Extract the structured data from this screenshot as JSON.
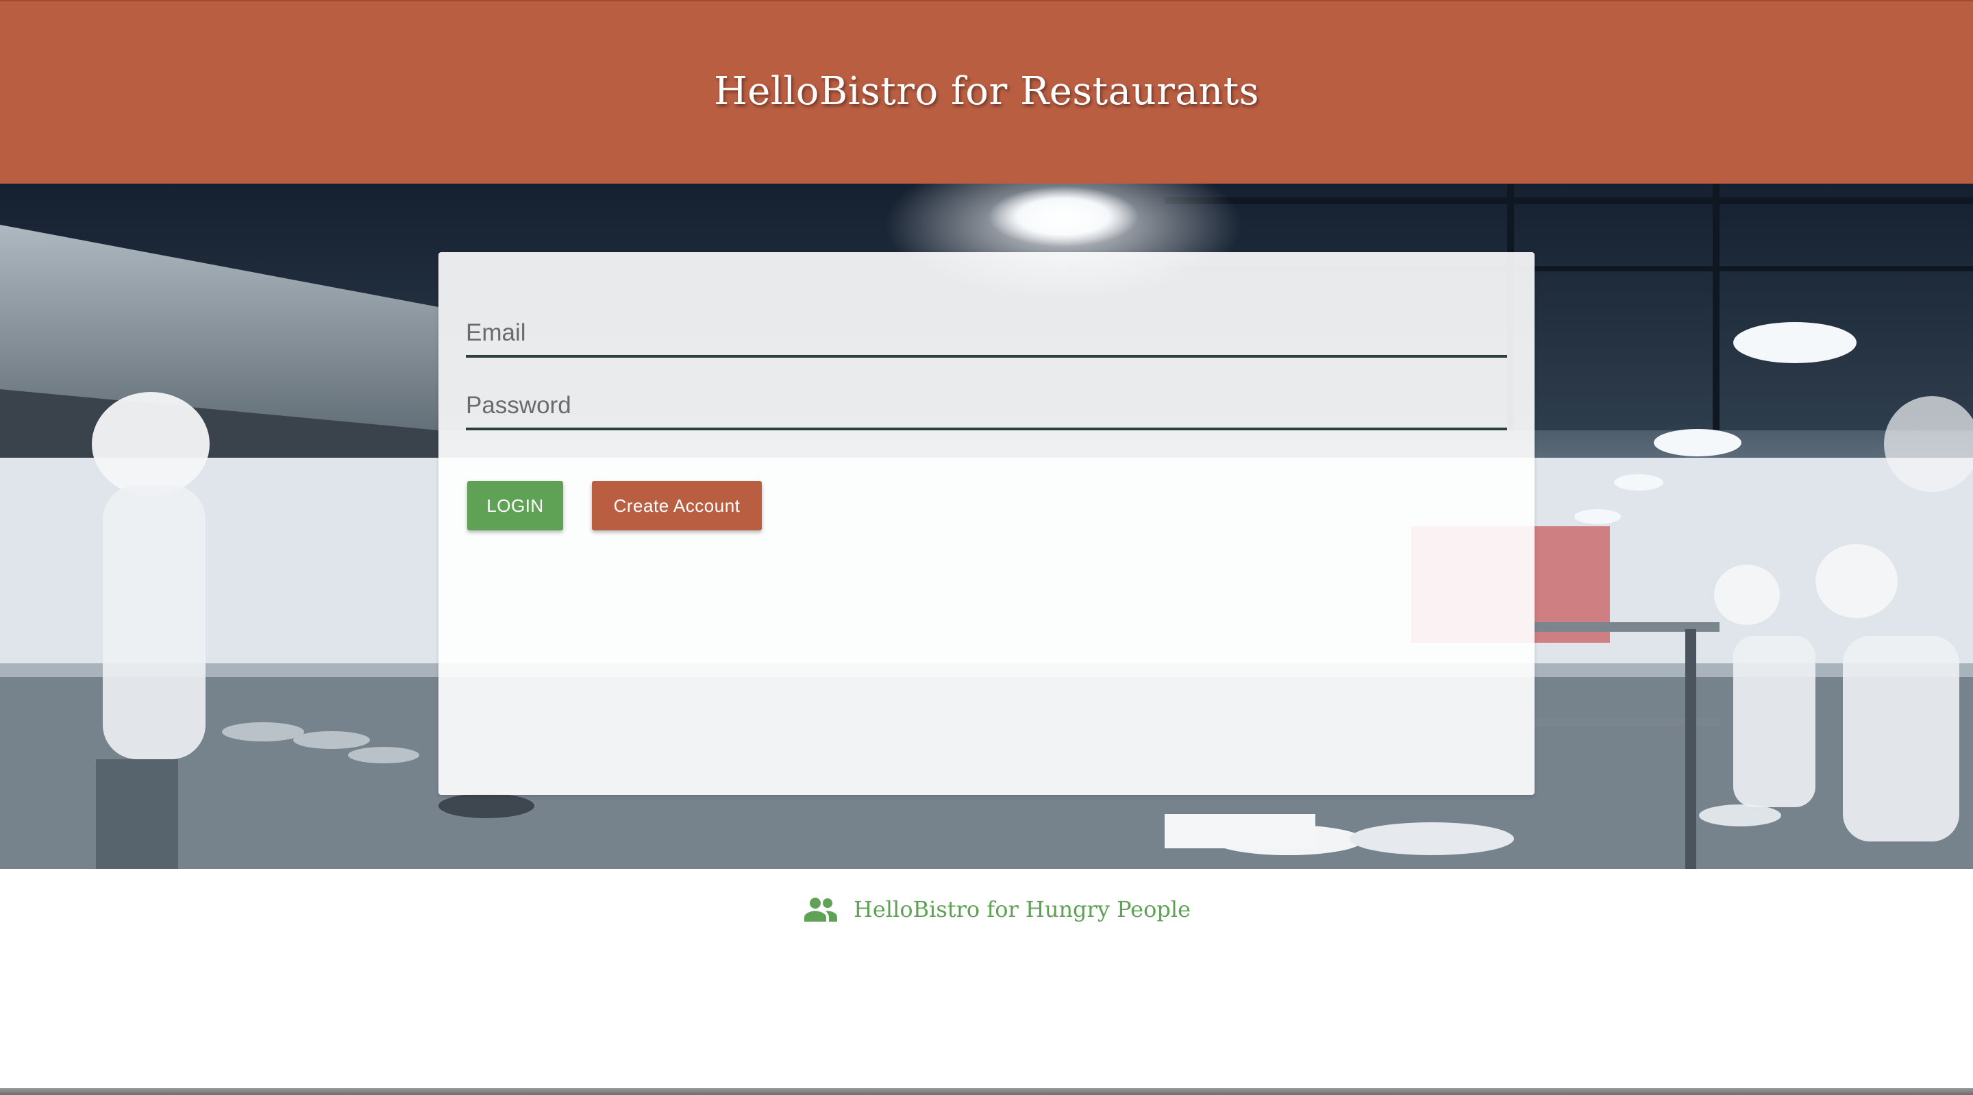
{
  "header": {
    "title": "HelloBistro for Restaurants"
  },
  "login_form": {
    "email": {
      "value": "",
      "placeholder": "Email"
    },
    "password": {
      "value": "",
      "placeholder": "Password"
    },
    "login_label": "LOGIN",
    "create_account_label": "Create Account"
  },
  "footer": {
    "link_label": "HelloBistro for Hungry People",
    "link_icon": "people-icon"
  },
  "colors": {
    "header_bg": "#ba5e42",
    "login_button": "#5fa256",
    "create_button": "#ba5e42",
    "footer_link": "#5fa256"
  }
}
